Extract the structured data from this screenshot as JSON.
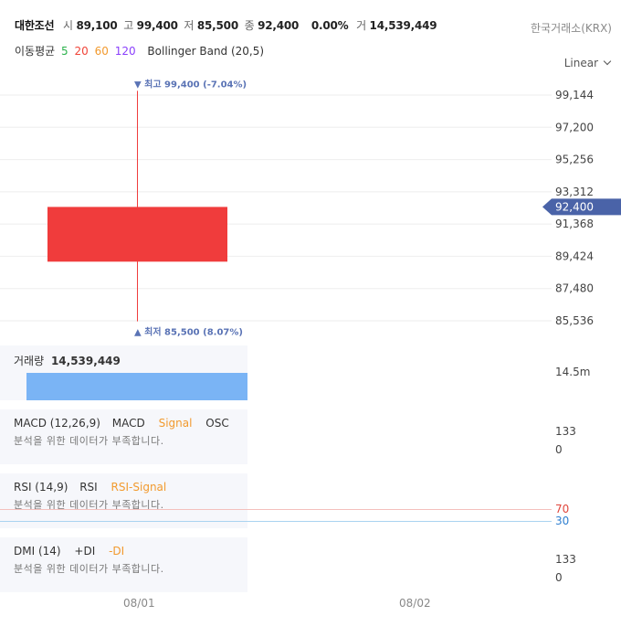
{
  "header": {
    "stock_name": "대한조선",
    "open_label": "시",
    "open_value": "89,100",
    "high_label": "고",
    "high_value": "99,400",
    "low_label": "저",
    "low_value": "85,500",
    "close_label": "종",
    "close_value": "92,400",
    "change_pct": "0.00%",
    "volume_label": "거",
    "volume_value": "14,539,449",
    "exchange": "한국거래소(KRX)"
  },
  "ma_legend": {
    "label": "이동평균",
    "periods": [
      {
        "text": "5",
        "color": "#2bb24c"
      },
      {
        "text": "20",
        "color": "#f04438"
      },
      {
        "text": "60",
        "color": "#f29a2e"
      },
      {
        "text": "120",
        "color": "#8a3ffc"
      }
    ],
    "bollinger": "Bollinger Band (20,5)"
  },
  "scale_mode": "Linear",
  "colors": {
    "up": "#f03c3c",
    "volume": "#7ab4f5",
    "price_tag": "#4a63a8",
    "annotation": "#5a73b5"
  },
  "chart_data": {
    "type": "candlestick",
    "x_tick_labels": [
      "08/01",
      "08/02"
    ],
    "candles": [
      {
        "date": "08/01",
        "open": 89100,
        "high": 99400,
        "low": 85500,
        "close": 92400,
        "volume": 14539449
      }
    ],
    "y_tick_labels": [
      "99,144",
      "97,200",
      "95,256",
      "93,312",
      "91,368",
      "89,424",
      "87,480",
      "85,536"
    ],
    "ylim": [
      85536,
      99144
    ],
    "current_price_label": "92,400",
    "high_annotation": "▼ 최고 99,400 (-7.04%)",
    "low_annotation": "▲ 최저 85,500 (8.07%)",
    "volume": {
      "title": "거래량",
      "value_text": "14,539,449",
      "axis_label": "14.5m"
    }
  },
  "panels": {
    "macd": {
      "title": "MACD (12,26,9)",
      "s1": "MACD",
      "s2": "Signal",
      "s3": "OSC",
      "message": "분석을 위한 데이터가 부족합니다.",
      "y_top": "133",
      "y_bottom": "0"
    },
    "rsi": {
      "title": "RSI (14,9)",
      "s1": "RSI",
      "s2": "RSI-Signal",
      "message": "분석을 위한 데이터가 부족합니다.",
      "level_high": "70",
      "level_low": "30"
    },
    "dmi": {
      "title": "DMI (14)",
      "s1": "+DI",
      "s2": "-DI",
      "message": "분석을 위한 데이터가 부족합니다.",
      "y_top": "133",
      "y_bottom": "0"
    }
  }
}
